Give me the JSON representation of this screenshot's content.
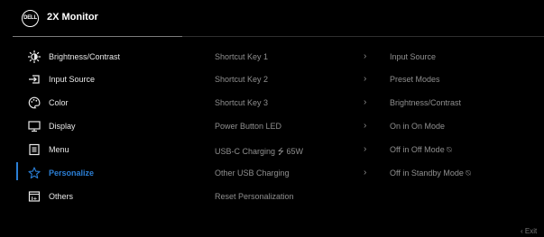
{
  "header": {
    "logo": "DELL",
    "title": "2X Monitor"
  },
  "sidebar": {
    "items": [
      {
        "label": "Brightness/Contrast",
        "icon": "brightness-icon"
      },
      {
        "label": "Input Source",
        "icon": "input-source-icon"
      },
      {
        "label": "Color",
        "icon": "color-palette-icon"
      },
      {
        "label": "Display",
        "icon": "display-icon"
      },
      {
        "label": "Menu",
        "icon": "menu-icon"
      },
      {
        "label": "Personalize",
        "icon": "star-icon",
        "active": true
      },
      {
        "label": "Others",
        "icon": "others-icon"
      }
    ]
  },
  "options": [
    {
      "label": "Shortcut Key 1",
      "value": "Input Source"
    },
    {
      "label": "Shortcut Key 2",
      "value": "Preset Modes"
    },
    {
      "label": "Shortcut Key 3",
      "value": "Brightness/Contrast"
    },
    {
      "label": "Power Button LED",
      "value": "On in On Mode"
    },
    {
      "label": "USB-C Charging ⭍ 65W",
      "value": "Off in Off Mode ⍉"
    },
    {
      "label": "Other USB Charging",
      "value": "Off in Standby Mode ⍉"
    },
    {
      "label": "Reset Personalization",
      "value": ""
    }
  ],
  "footer": {
    "exit_label": "Exit",
    "exit_icon": "‹"
  },
  "colors": {
    "accent": "#2b7fd6",
    "background": "#000000"
  }
}
